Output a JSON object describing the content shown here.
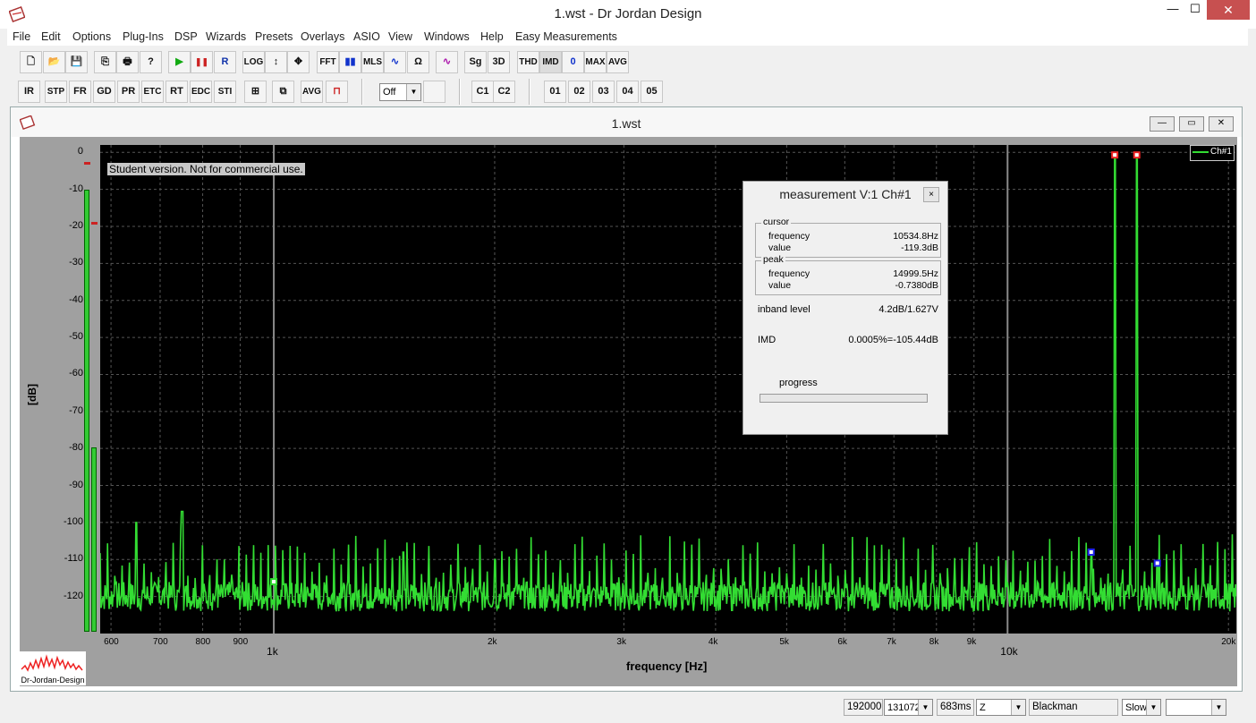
{
  "window": {
    "title": "1.wst - Dr Jordan Design",
    "min": "—",
    "max": "☐",
    "close": "✕"
  },
  "menu": [
    "File",
    "Edit",
    "Options",
    "Plug-Ins",
    "DSP",
    "Wizards",
    "Presets",
    "Overlays",
    "ASIO",
    "View",
    "Windows",
    "Help",
    "Easy Measurements"
  ],
  "toolbar1": {
    "new": "🗋",
    "open": "📂",
    "save": "💾",
    "copy": "⎘",
    "print": "🖶",
    "help": "?",
    "play": "▶",
    "pause": "❚❚",
    "rec": "R",
    "log": "LOG",
    "vzoom": "↕",
    "pan": "✥",
    "fft": "FFT",
    "spectrum": "▮▮",
    "mls": "MLS",
    "sine": "∿",
    "ohm": "Ω",
    "wave": "∿",
    "sg": "Sg",
    "3d": "3D",
    "thd": "THD",
    "imd": "IMD",
    "zero": "0",
    "max": "MAX",
    "avg": "AVG"
  },
  "toolbar2": {
    "ir": "IR",
    "stp": "STP",
    "fr": "FR",
    "gd": "GD",
    "pr": "PR",
    "etc": "ETC",
    "rt": "RT",
    "edc": "EDC",
    "sti": "STI",
    "b1": "⊞",
    "b2": "⧉",
    "avg": "AVG",
    "b3": "⊓",
    "combo": "Off",
    "c1": "C1",
    "c2": "C2",
    "o1": "01",
    "o2": "02",
    "o3": "03",
    "o4": "04",
    "o5": "05"
  },
  "doc": {
    "title": "1.wst"
  },
  "watermark": "Student version. Not for commercial use.",
  "legend": "Ch#1",
  "logo": "Dr-Jordan-Design",
  "measurement": {
    "title": "measurement V:1 Ch#1",
    "close": "×",
    "cursor_label": "cursor",
    "peak_label": "peak",
    "cursor_freq_label": "frequency",
    "cursor_freq": "10534.8Hz",
    "cursor_val_label": "value",
    "cursor_val": "-119.3dB",
    "peak_freq_label": "frequency",
    "peak_freq": "14999.5Hz",
    "peak_val_label": "value",
    "peak_val": "-0.7380dB",
    "inband_label": "inband level",
    "inband": "4.2dB/1.627V",
    "imd_label": "IMD",
    "imd": "0.0005%=-105.44dB",
    "progress_label": "progress",
    "progress": 0.0
  },
  "status": {
    "rate": "192000",
    "fft": "131072",
    "time": "683ms",
    "z": "Z",
    "window": "Blackman",
    "speed": "Slow",
    "extra": ""
  },
  "chart_data": {
    "type": "line",
    "xlabel": "frequency [Hz]",
    "ylabel": "[dB]",
    "xscale": "log",
    "xlim": [
      580,
      20500
    ],
    "ylim": [
      -130,
      2
    ],
    "yticks": [
      0,
      -10,
      -20,
      -30,
      -40,
      -50,
      -60,
      -70,
      -80,
      -90,
      -100,
      -110,
      -120
    ],
    "xticks": [
      "600",
      "700",
      "800",
      "900",
      "1k",
      "2k",
      "3k",
      "4k",
      "5k",
      "6k",
      "7k",
      "8k",
      "9k",
      "10k",
      "20k"
    ],
    "series": [
      {
        "name": "Ch#1",
        "color": "#33dd33",
        "peaks": [
          [
            650,
            -100
          ],
          [
            750,
            -97
          ],
          [
            1500,
            -108
          ],
          [
            2000,
            -110
          ],
          [
            13000,
            -108
          ],
          [
            14000,
            -0.7
          ],
          [
            15000,
            -0.7
          ],
          [
            16000,
            -111
          ]
        ],
        "noise_floor": -120
      }
    ]
  }
}
